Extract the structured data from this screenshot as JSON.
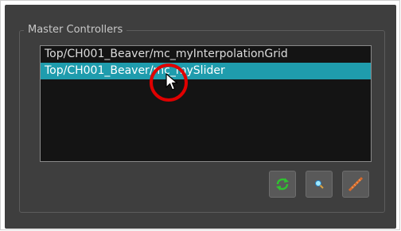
{
  "group": {
    "title": "Master Controllers"
  },
  "list": {
    "items": [
      {
        "label": "Top/CH001_Beaver/mc_myInterpolationGrid",
        "selected": false
      },
      {
        "label": "Top/CH001_Beaver/mc_mySlider",
        "selected": true
      }
    ]
  },
  "toolbar": {
    "buttons": [
      {
        "icon": "refresh-icon"
      },
      {
        "icon": "select-node-icon"
      },
      {
        "icon": "edit-ruler-icon"
      }
    ]
  },
  "colors": {
    "panel_bg": "#3e3e3e",
    "list_bg": "#141414",
    "selection": "#1f9cad",
    "highlight_ring": "#e00000"
  }
}
